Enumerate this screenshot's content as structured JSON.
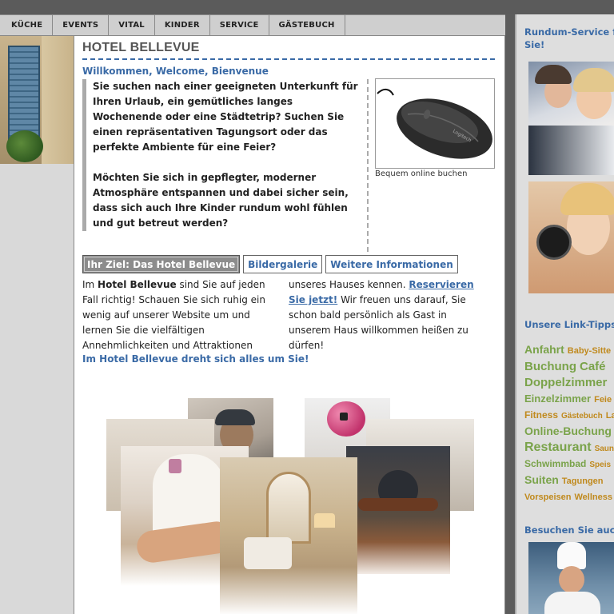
{
  "nav": {
    "items": [
      "KÜCHE",
      "EVENTS",
      "VITAL",
      "KINDER",
      "SERVICE",
      "GÄSTEBUCH"
    ]
  },
  "main": {
    "title": "HOTEL BELLEVUE",
    "welcome": "Willkommen, Welcome, Bienvenue",
    "intro_p1": "Sie suchen nach einer geeigneten Unterkunft für Ihren Urlaub, ein gemütliches langes Wochenende oder eine Städtetrip? Suchen Sie einen repräsentativen Tagungsort oder das perfekte Ambiente für eine Feier?",
    "intro_p2": "Möchten Sie sich in gepflegter, moderner Atmosphäre entspannen und dabei sicher sein, dass sich auch Ihre Kinder rundum wohl fühlen und gut betreut werden?",
    "mouse_caption": "Bequem online buchen",
    "mouse_brand": "Logitech",
    "tabs": [
      "Ihr Ziel: Das Hotel Bellevue",
      "Bildergalerie",
      "Weitere Informationen"
    ],
    "col1_prefix": "Im ",
    "col1_bold": "Hotel Bellevue",
    "col1_rest": " sind Sie auf jeden Fall richtig! Schauen Sie sich ruhig ein wenig auf unserer Website um und lernen Sie die vielfältigen Annehmlichkeiten und Attraktionen",
    "col2_text": "unseres Hauses kennen. ",
    "col2_link": "Reservieren Sie jetzt!",
    "col2_rest": " Wir freuen uns darauf, Sie schon bald persönlich als Gast in unserem Haus willkommen heißen zu dürfen!",
    "tagline": "Im Hotel Bellevue dreht sich alles um Sie!"
  },
  "right": {
    "heading1_line1": "Rundum-Service f",
    "heading1_line2": "Sie!",
    "heading2": "Unsere Link-Tipps",
    "heading3": "Besuchen Sie auc",
    "tag_rows": [
      [
        {
          "t": "Anfahrt",
          "c": "#7aa34a",
          "s": 14
        },
        {
          "t": "Baby-Sitte",
          "c": "#c08a1e",
          "s": 11
        }
      ],
      [
        {
          "t": "Buchung",
          "c": "#7aa34a",
          "s": 15
        },
        {
          "t": "Café",
          "c": "#7aa34a",
          "s": 15
        }
      ],
      [
        {
          "t": "Doppelzimmer",
          "c": "#7aa34a",
          "s": 15
        }
      ],
      [
        {
          "t": "Einzelzimmer",
          "c": "#7aa34a",
          "s": 13
        },
        {
          "t": "Feie",
          "c": "#c08a1e",
          "s": 11
        }
      ],
      [
        {
          "t": "Fitness",
          "c": "#c08a1e",
          "s": 12
        },
        {
          "t": "Gästebuch",
          "c": "#c08a1e",
          "s": 10
        },
        {
          "t": "La",
          "c": "#c08a1e",
          "s": 11
        }
      ],
      [
        {
          "t": "Online-Buchung",
          "c": "#7aa34a",
          "s": 14
        }
      ],
      [
        {
          "t": "Restaurant",
          "c": "#7aa34a",
          "s": 16
        },
        {
          "t": "Saun",
          "c": "#c08a1e",
          "s": 10
        }
      ],
      [
        {
          "t": "Schwimmbad",
          "c": "#7aa34a",
          "s": 12
        },
        {
          "t": "Speis",
          "c": "#c08a1e",
          "s": 10
        }
      ],
      [
        {
          "t": "Suiten",
          "c": "#7aa34a",
          "s": 14
        },
        {
          "t": "Tagungen",
          "c": "#c08a1e",
          "s": 11
        }
      ],
      [
        {
          "t": "Vorspeisen",
          "c": "#c08a1e",
          "s": 11
        },
        {
          "t": "Wellness",
          "c": "#c08a1e",
          "s": 11
        }
      ]
    ]
  },
  "colors": {
    "accent_blue": "#3a6aa6",
    "tag_green": "#7aa34a",
    "tag_orange": "#c08a1e",
    "tab_active_bg": "#8c8c8c"
  }
}
